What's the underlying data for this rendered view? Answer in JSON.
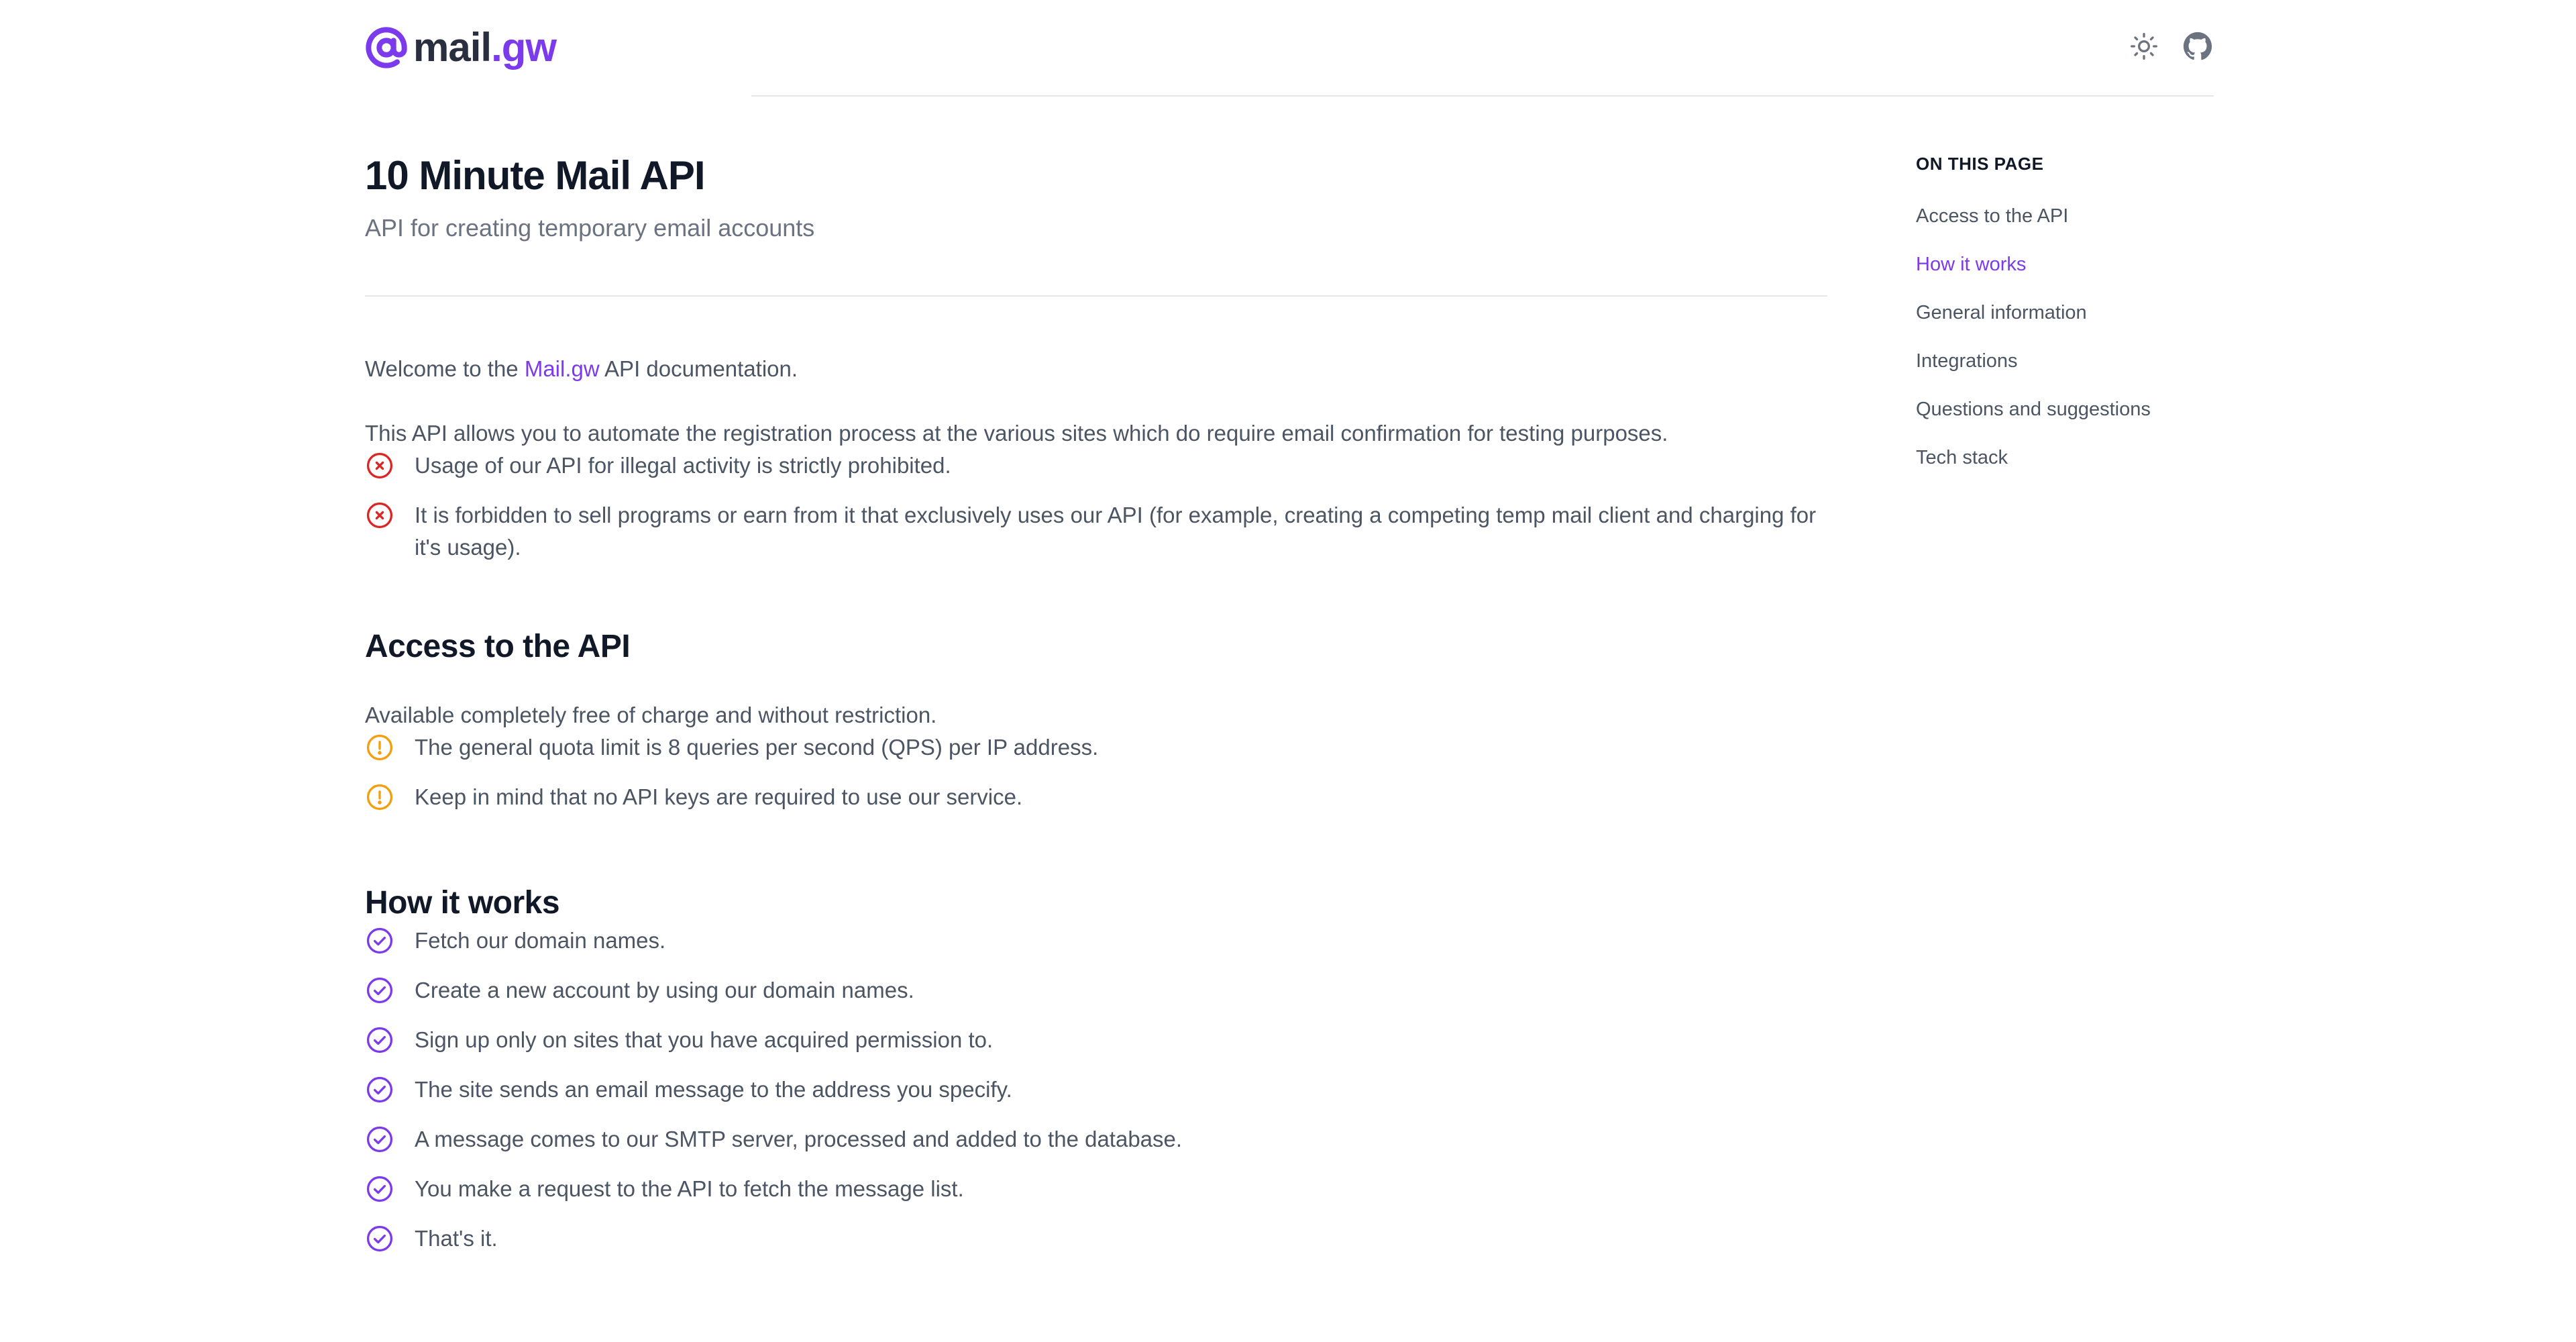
{
  "header": {
    "logo_name": "mail",
    "logo_tld": ".gw",
    "icons": [
      "sun-icon",
      "github-icon"
    ]
  },
  "main": {
    "title": "10 Minute Mail API",
    "subtitle": "API for creating temporary email accounts",
    "welcome_prefix": "Welcome to the ",
    "welcome_link": "Mail.gw",
    "welcome_suffix": " API documentation.",
    "intro": "This API allows you to automate the registration process at the various sites which do require email confirmation for testing purposes.",
    "rules": [
      "Usage of our API for illegal activity is strictly prohibited.",
      "It is forbidden to sell programs or earn from it that exclusively uses our API (for example, creating a competing temp mail client and charging for it's usage)."
    ],
    "access": {
      "heading": "Access to the API",
      "text": "Available completely free of charge and without restriction.",
      "notes": [
        "The general quota limit is 8 queries per second (QPS) per IP address.",
        "Keep in mind that no API keys are required to use our service."
      ]
    },
    "how": {
      "heading": "How it works",
      "steps": [
        "Fetch our domain names.",
        "Create a new account by using our domain names.",
        "Sign up only on sites that you have acquired permission to.",
        "The site sends an email message to the address you specify.",
        "A message comes to our SMTP server, processed and added to the database.",
        "You make a request to the API to fetch the message list.",
        "That's it."
      ]
    }
  },
  "toc": {
    "heading": "ON THIS PAGE",
    "items": [
      "Access to the API",
      "How it works",
      "General information",
      "Integrations",
      "Questions and suggestions",
      "Tech stack"
    ],
    "active_index": 1
  },
  "colors": {
    "accent": "#7c3aed",
    "error": "#dc2626",
    "warning": "#f59e0b",
    "heading": "#111827",
    "body": "#4b5563"
  }
}
